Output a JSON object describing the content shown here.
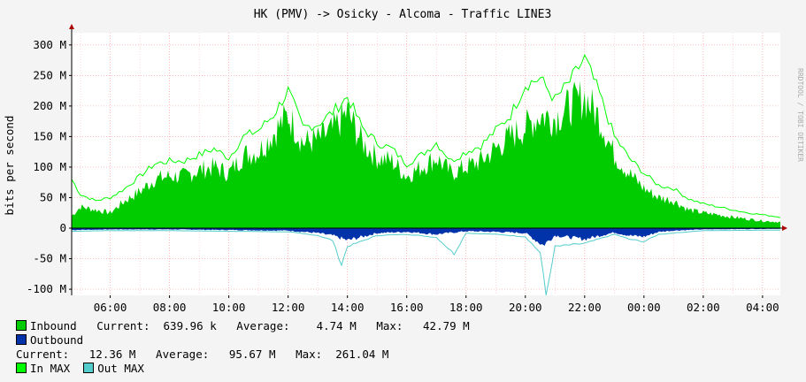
{
  "chart_data": {
    "type": "area",
    "title": "HK (PMV) -> Osicky - Alcoma - Traffic LINE3",
    "ylabel": "bits per second",
    "watermark": "RRDTOOL / TOBI OETIKER",
    "ylim": [
      -110,
      320
    ],
    "y_unit": "M",
    "y_ticks": [
      -100,
      -50,
      0,
      50,
      100,
      150,
      200,
      250,
      300
    ],
    "y_tick_labels": [
      "-100 M",
      "-50 M",
      "0",
      "50 M",
      "100 M",
      "150 M",
      "200 M",
      "250 M",
      "300 M"
    ],
    "x_start_hour": 4.7,
    "x_end_hour": 28.6,
    "x_tick_hours": [
      6,
      8,
      10,
      12,
      14,
      16,
      18,
      20,
      22,
      24,
      26,
      28
    ],
    "x_tick_labels": [
      "06:00",
      "08:00",
      "10:00",
      "12:00",
      "14:00",
      "16:00",
      "18:00",
      "20:00",
      "22:00",
      "00:00",
      "02:00",
      "04:00"
    ],
    "grid": true,
    "colors": {
      "inbound": "#00CC00",
      "outbound": "#0033AA",
      "in_max": "#00FF00",
      "out_max": "#55CCCC",
      "grid": "#ff9999",
      "axis": "#000000"
    },
    "series": [
      {
        "name": "Inbound",
        "hours": [
          4.7,
          5.0,
          5.5,
          6.0,
          6.5,
          7.0,
          7.5,
          8.0,
          8.5,
          9.0,
          9.5,
          10.0,
          10.5,
          11.0,
          11.5,
          12.0,
          12.5,
          13.0,
          13.5,
          14.0,
          14.5,
          15.0,
          15.5,
          16.0,
          16.5,
          17.0,
          17.5,
          18.0,
          18.5,
          19.0,
          19.5,
          20.0,
          20.5,
          21.0,
          21.5,
          22.0,
          22.5,
          23.0,
          23.5,
          24.0,
          24.5,
          25.0,
          25.5,
          26.0,
          26.5,
          27.0,
          27.5,
          28.0,
          28.6
        ],
        "values": [
          20,
          35,
          30,
          25,
          45,
          60,
          80,
          85,
          85,
          95,
          100,
          90,
          120,
          125,
          155,
          185,
          140,
          145,
          160,
          190,
          140,
          115,
          110,
          85,
          100,
          115,
          90,
          100,
          110,
          130,
          150,
          165,
          185,
          180,
          200,
          215,
          180,
          120,
          90,
          65,
          50,
          45,
          30,
          25,
          22,
          18,
          15,
          12,
          10
        ]
      },
      {
        "name": "Outbound",
        "hours": [
          4.7,
          6.0,
          8.0,
          10.0,
          12.0,
          13.0,
          13.5,
          14.0,
          15.0,
          16.0,
          17.0,
          18.0,
          19.0,
          20.0,
          20.6,
          21.0,
          22.0,
          23.0,
          23.5,
          24.0,
          24.5,
          25.0,
          26.0,
          28.6
        ],
        "values": [
          -3,
          -2,
          -2,
          -3,
          -4,
          -8,
          -12,
          -20,
          -8,
          -6,
          -10,
          -5,
          -6,
          -8,
          -28,
          -12,
          -18,
          -7,
          -12,
          -14,
          -6,
          -4,
          -2,
          -1
        ]
      },
      {
        "name": "In MAX",
        "hours": [
          4.7,
          5.0,
          5.5,
          6.0,
          6.5,
          7.0,
          7.5,
          8.0,
          8.5,
          9.0,
          9.5,
          10.0,
          10.5,
          11.0,
          11.5,
          12.0,
          12.5,
          13.0,
          13.5,
          14.0,
          14.5,
          15.0,
          15.5,
          16.0,
          16.5,
          17.0,
          17.5,
          18.0,
          18.5,
          19.0,
          19.5,
          20.0,
          20.5,
          21.0,
          21.5,
          22.0,
          22.5,
          23.0,
          23.5,
          24.0,
          24.5,
          25.0,
          25.5,
          26.0,
          26.5,
          27.0,
          27.5,
          28.0,
          28.6
        ],
        "values": [
          80,
          55,
          45,
          50,
          65,
          85,
          105,
          110,
          110,
          120,
          130,
          115,
          150,
          160,
          185,
          225,
          165,
          170,
          190,
          215,
          165,
          140,
          130,
          105,
          120,
          140,
          110,
          125,
          135,
          160,
          185,
          235,
          245,
          210,
          240,
          278,
          220,
          150,
          115,
          90,
          70,
          65,
          48,
          40,
          35,
          30,
          25,
          22,
          18
        ]
      },
      {
        "name": "Out MAX",
        "hours": [
          4.7,
          6.0,
          8.0,
          10.0,
          12.0,
          13.0,
          13.5,
          13.8,
          14.0,
          15.0,
          16.0,
          17.0,
          17.6,
          18.0,
          19.0,
          20.0,
          20.5,
          20.7,
          21.0,
          22.0,
          23.0,
          23.5,
          24.0,
          24.5,
          25.0,
          26.0,
          28.6
        ],
        "values": [
          -5,
          -4,
          -4,
          -5,
          -6,
          -12,
          -20,
          -60,
          -30,
          -12,
          -10,
          -15,
          -42,
          -8,
          -10,
          -14,
          -40,
          -110,
          -30,
          -25,
          -10,
          -18,
          -22,
          -10,
          -8,
          -4,
          -3
        ]
      }
    ]
  },
  "legend": {
    "inbound_label": "Inbound",
    "inbound_stats": "   Current:  639.96 k   Average:    4.74 M   Max:   42.79 M",
    "outbound_label": "Outbound",
    "outbound_stats": "Current:   12.36 M   Average:   95.67 M   Max:  261.04 M",
    "in_max_label": "In MAX",
    "out_max_label": "Out MAX"
  }
}
